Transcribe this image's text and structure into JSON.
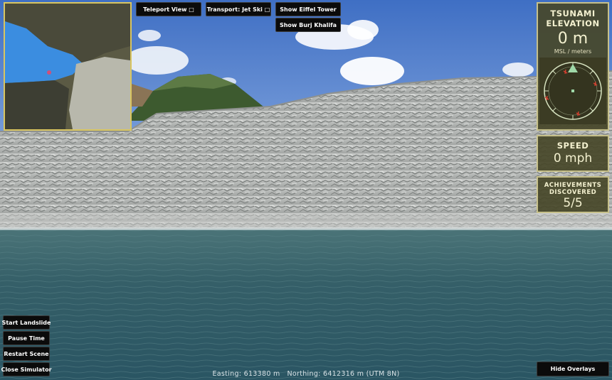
{
  "top_buttons": {
    "teleport": "Teleport View □",
    "transport": "Transport: Jet Ski □",
    "eiffel": "Show Eiffel Tower",
    "burj": "Show Burj Khalifa"
  },
  "elevation": {
    "title_line1": "TSUNAMI",
    "title_line2": "ELEVATION",
    "value": "0 m",
    "unit": "MSL / meters"
  },
  "speed": {
    "title": "SPEED",
    "value": "0 mph"
  },
  "achievements": {
    "title_line1": "ACHIEVEMENTS",
    "title_line2": "DISCOVERED",
    "value": "5/5"
  },
  "left_buttons": {
    "start": "Start Landslide",
    "pause": "Pause Time",
    "restart": "Restart Scene",
    "close": "Close Simulator"
  },
  "hide_overlays": "Hide Overlays",
  "coordinates": "Easting: 613380 m   Northing: 6412316 m (UTM 8N)",
  "colors": {
    "panel_bg": "#46462a",
    "panel_border": "#c6c08a",
    "minimap_border": "#d9c560",
    "water": "#2f5b66",
    "sky": "#5f8fd6"
  }
}
